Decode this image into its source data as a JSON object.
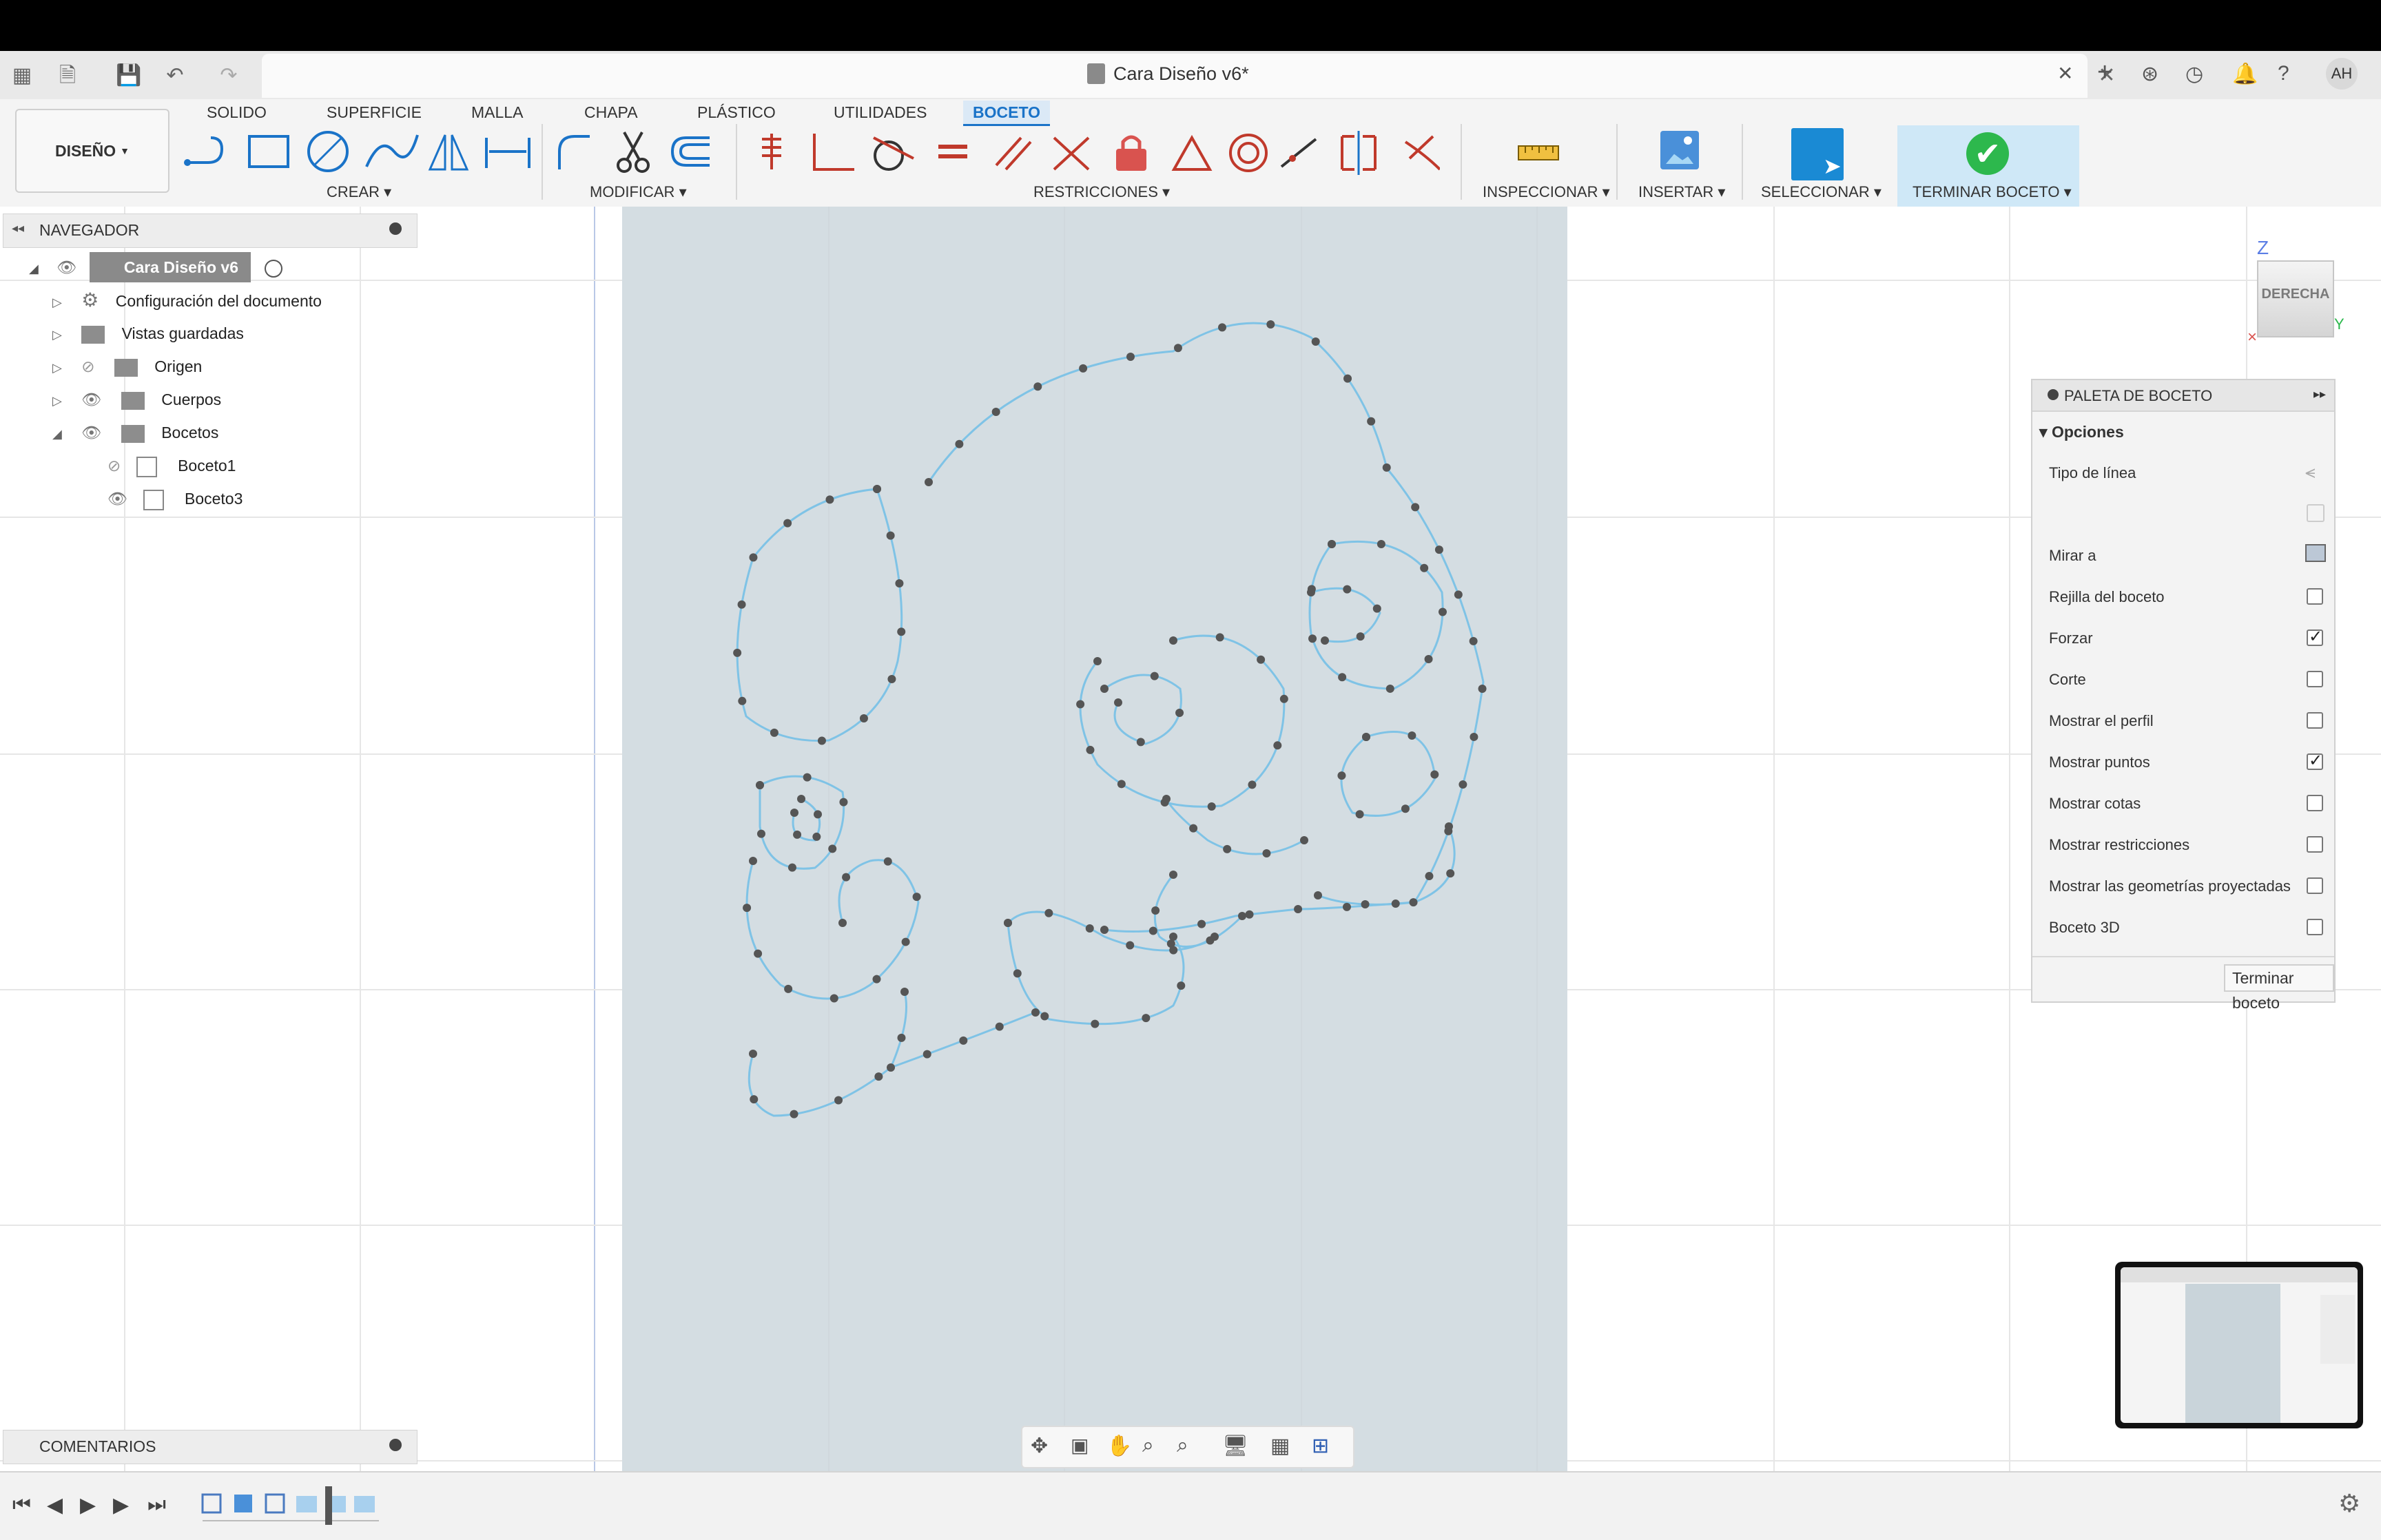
{
  "window": {
    "doc_title": "Cara Diseño v6*",
    "user_initials": "AH"
  },
  "ribbon": {
    "workspace": "DISEÑO",
    "tabs": [
      {
        "label": "SOLIDO",
        "active": false
      },
      {
        "label": "SUPERFICIE",
        "active": false
      },
      {
        "label": "MALLA",
        "active": false
      },
      {
        "label": "CHAPA",
        "active": false
      },
      {
        "label": "PLÁSTICO",
        "active": false
      },
      {
        "label": "UTILIDADES",
        "active": false
      },
      {
        "label": "BOCETO",
        "active": true
      }
    ],
    "groups": {
      "crear": "CREAR",
      "modificar": "MODIFICAR",
      "restricciones": "RESTRICCIONES",
      "inspeccionar": "INSPECCIONAR",
      "insertar": "INSERTAR",
      "seleccionar": "SELECCIONAR",
      "terminar": "TERMINAR BOCETO"
    },
    "accent": "#1a73c8",
    "finish_color": "#2db84d"
  },
  "navigator": {
    "title": "NAVEGADOR",
    "root": "Cara Diseño v6",
    "items": [
      {
        "label": "Configuración del documento",
        "icon": "gear-icon"
      },
      {
        "label": "Vistas guardadas",
        "icon": "folder-icon"
      },
      {
        "label": "Origen",
        "icon": "folder-icon",
        "visible": false
      },
      {
        "label": "Cuerpos",
        "icon": "folder-icon",
        "visible": true
      },
      {
        "label": "Bocetos",
        "icon": "folder-icon",
        "visible": true,
        "expanded": true
      }
    ],
    "sketches": [
      {
        "label": "Boceto1",
        "visible": false
      },
      {
        "label": "Boceto3",
        "visible": true
      }
    ]
  },
  "comments": {
    "title": "COMENTARIOS"
  },
  "viewcube": {
    "face": "DERECHA",
    "axis_z": "Z",
    "axis_y": "Y"
  },
  "palette": {
    "title": "PALETA DE BOCETO",
    "section": "Opciones",
    "rows": [
      {
        "label": "Tipo de línea",
        "kind": "icon"
      },
      {
        "label": "",
        "kind": "icon"
      },
      {
        "label": "Mirar a",
        "kind": "icon"
      },
      {
        "label": "Rejilla del boceto",
        "kind": "check",
        "checked": false
      },
      {
        "label": "Forzar",
        "kind": "check",
        "checked": true
      },
      {
        "label": "Corte",
        "kind": "check",
        "checked": false
      },
      {
        "label": "Mostrar el perfil",
        "kind": "check",
        "checked": false
      },
      {
        "label": "Mostrar puntos",
        "kind": "check",
        "checked": true
      },
      {
        "label": "Mostrar cotas",
        "kind": "check",
        "checked": false
      },
      {
        "label": "Mostrar restricciones",
        "kind": "check",
        "checked": false
      },
      {
        "label": "Mostrar las geometrías proyectadas",
        "kind": "check",
        "checked": false
      },
      {
        "label": "Boceto 3D",
        "kind": "check",
        "checked": false
      }
    ],
    "finish_button": "Terminar boceto"
  }
}
